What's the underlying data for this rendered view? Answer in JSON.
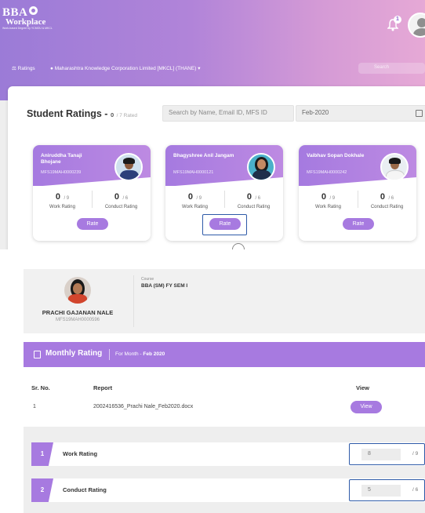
{
  "header": {
    "brand_line1": "BBA",
    "brand_line2": "Workplace",
    "brand_line3": "Work-based Degree by YCMOU & MKCL",
    "notification_count": "1"
  },
  "subnav": {
    "ratings_label": "Ratings",
    "org_label": "Maharashtra Knowledge Corporation Limited [MKCL] (THANE)",
    "search_placeholder": "Search"
  },
  "student_ratings": {
    "title": "Student Ratings -",
    "count": "0",
    "rated_suffix": "/ 7 Rated",
    "search_placeholder": "Search by Name, Email ID, MFS ID",
    "month": "Feb-2020",
    "students": [
      {
        "name": "Aniruddha Tanaji Bhojane",
        "id": "MFS19MAH0000239",
        "work_score": "0",
        "work_max": "/ 9",
        "work_label": "Work Rating",
        "conduct_score": "0",
        "conduct_max": "/ 6",
        "conduct_label": "Conduct Rating",
        "rate_label": "Rate"
      },
      {
        "name": "Bhagyshree Anil Jangam",
        "id": "MFS19MAH0000121",
        "work_score": "0",
        "work_max": "/ 9",
        "work_label": "Work Rating",
        "conduct_score": "0",
        "conduct_max": "/ 6",
        "conduct_label": "Conduct Rating",
        "rate_label": "Rate"
      },
      {
        "name": "Vaibhav Sopan Dokhale",
        "id": "MFS19MAH0000242",
        "work_score": "0",
        "work_max": "/ 9",
        "work_label": "Work Rating",
        "conduct_score": "0",
        "conduct_max": "/ 6",
        "conduct_label": "Conduct Rating",
        "rate_label": "Rate"
      }
    ]
  },
  "profile": {
    "name": "PRACHI GAJANAN NALE",
    "id": "MFS19MAH0000596",
    "course_label": "Course",
    "course": "BBA (SM) FY SEM I"
  },
  "monthly_rating": {
    "title": "Monthly Rating",
    "for_month_label": "For Month -",
    "month": "Feb 2020",
    "headers": {
      "sr_no": "Sr. No.",
      "report": "Report",
      "view": "View"
    },
    "rows": [
      {
        "sr": "1",
        "report": "2002416536_Prachi Nale_Feb2020.docx",
        "view_label": "View"
      }
    ]
  },
  "ratings": [
    {
      "num": "1",
      "label": "Work Rating",
      "value": "8",
      "max": "/ 9"
    },
    {
      "num": "2",
      "label": "Conduct Rating",
      "value": "5",
      "max": "/ 6"
    }
  ],
  "colors": {
    "accent": "#a77ae0",
    "highlight_border": "#2e5aa8"
  }
}
